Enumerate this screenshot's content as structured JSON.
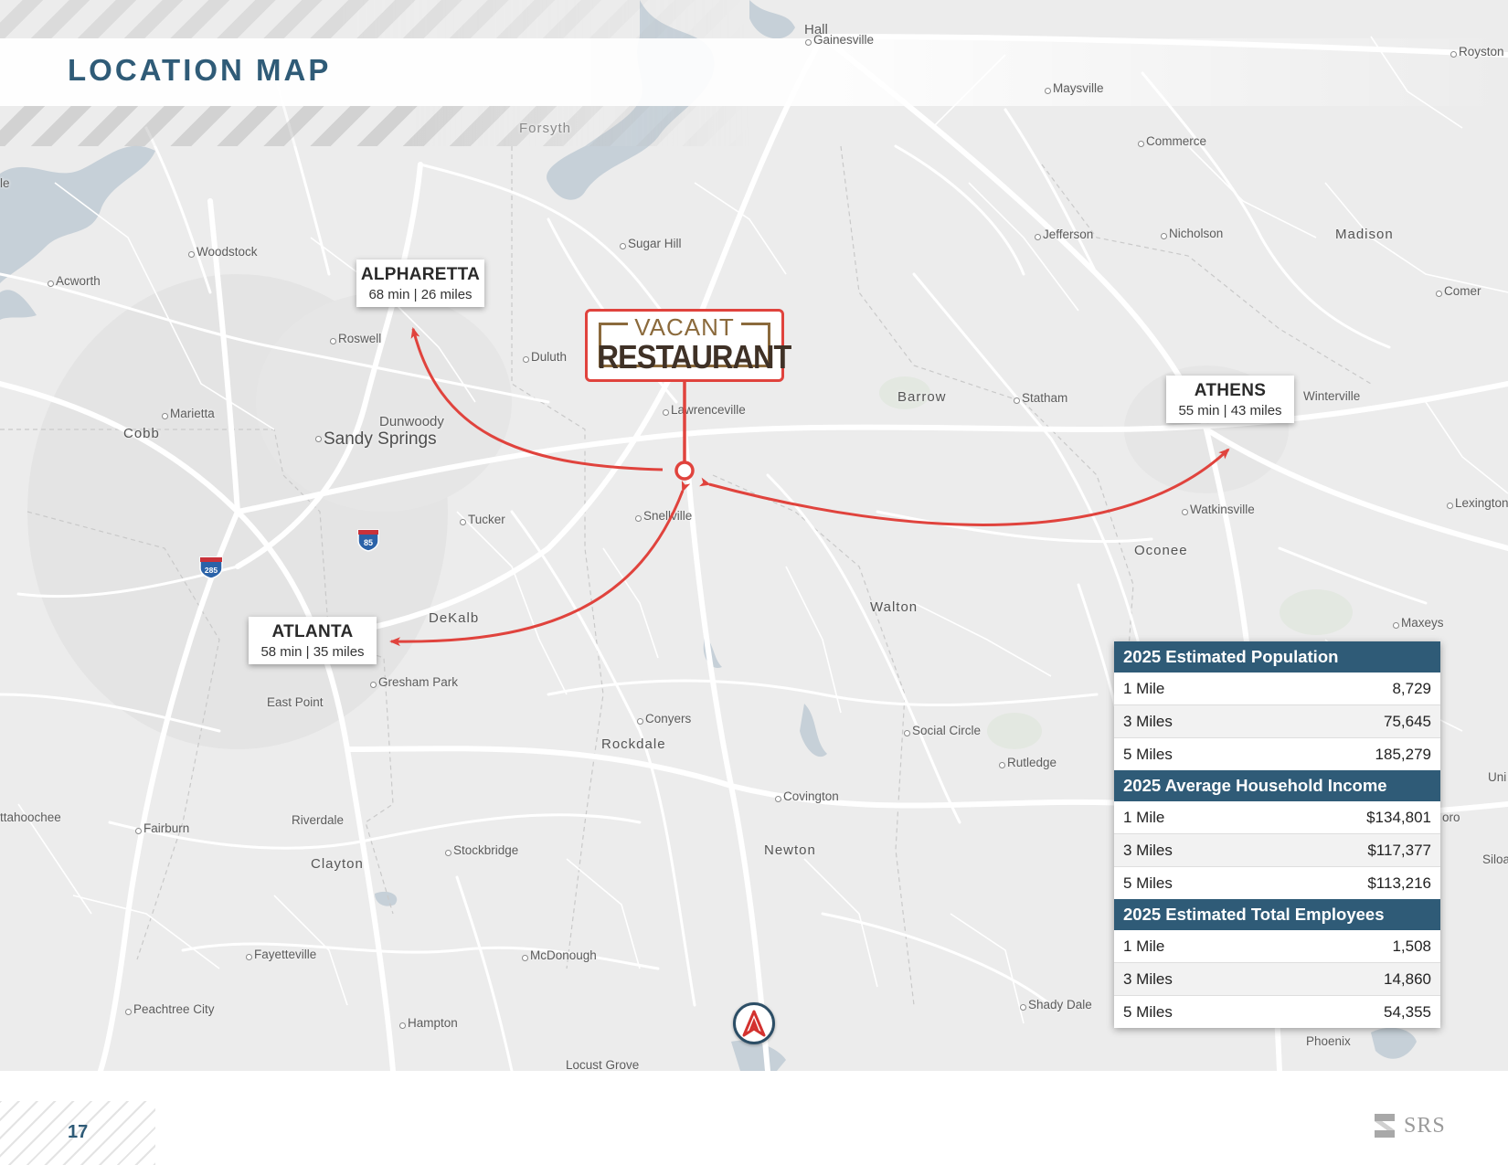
{
  "page": {
    "title": "LOCATION MAP",
    "page_number": "17",
    "logo_text": "SRS",
    "accent_color": "#2f5b77",
    "route_color": "#e0433d"
  },
  "site": {
    "label_top": "VACANT",
    "label_main": "RESTAURANT"
  },
  "destinations": [
    {
      "name": "ALPHARETTA",
      "distance": "68 min | 26 miles"
    },
    {
      "name": "ATHENS",
      "distance": "55 min | 43 miles"
    },
    {
      "name": "ATLANTA",
      "distance": "58 min | 35 miles"
    }
  ],
  "map_labels": {
    "hall": "Hall",
    "gainesville": "Gainesville",
    "royston": "Royston",
    "maysville": "Maysville",
    "forsyth": "Forsyth",
    "commerce": "Commerce",
    "woodstock": "Woodstock",
    "sugar_hill": "Sugar Hill",
    "jefferson": "Jefferson",
    "nicholson": "Nicholson",
    "madison": "Madison",
    "acworth": "Acworth",
    "comer": "Comer",
    "roswell": "Roswell",
    "duluth": "Duluth",
    "marietta": "Marietta",
    "cobb": "Cobb",
    "dunwoody": "Dunwoody",
    "sandy_springs": "Sandy Springs",
    "lawrenceville": "Lawrenceville",
    "barrow": "Barrow",
    "statham": "Statham",
    "winterville": "Winterville",
    "tucker": "Tucker",
    "snellville": "Snellville",
    "watkinsville": "Watkinsville",
    "lexington": "Lexington",
    "oconee": "Oconee",
    "dekalb": "DeKalb",
    "walton": "Walton",
    "maxeys": "Maxeys",
    "gresham_park": "Gresham Park",
    "east_point": "East Point",
    "conyers": "Conyers",
    "rockdale": "Rockdale",
    "social_circle": "Social Circle",
    "rutledge": "Rutledge",
    "covington": "Covington",
    "chattahoochee": "ttahoochee",
    "fairburn": "Fairburn",
    "riverdale": "Riverdale",
    "newton": "Newton",
    "stockbridge": "Stockbridge",
    "clayton": "Clayton",
    "fayetteville": "Fayetteville",
    "mcdonough": "McDonough",
    "peachtree_city": "Peachtree City",
    "hampton": "Hampton",
    "shady_dale": "Shady Dale",
    "phoenix": "Phoenix",
    "locust_grove": "Locust Grove",
    "uni": "Uni",
    "oro": "oro",
    "siloa": "Siloa",
    "le": "le",
    "i85": "85",
    "i285": "285"
  },
  "demographics": [
    {
      "heading": "2025 Estimated Population",
      "rows": [
        {
          "radius": "1 Mile",
          "value": "8,729"
        },
        {
          "radius": "3 Miles",
          "value": "75,645"
        },
        {
          "radius": "5 Miles",
          "value": "185,279"
        }
      ]
    },
    {
      "heading": "2025 Average Household Income",
      "rows": [
        {
          "radius": "1 Mile",
          "value": "$134,801"
        },
        {
          "radius": "3 Miles",
          "value": "$117,377"
        },
        {
          "radius": "5 Miles",
          "value": "$113,216"
        }
      ]
    },
    {
      "heading": "2025 Estimated Total Employees",
      "rows": [
        {
          "radius": "1 Mile",
          "value": "1,508"
        },
        {
          "radius": "3 Miles",
          "value": "14,860"
        },
        {
          "radius": "5 Miles",
          "value": "54,355"
        }
      ]
    }
  ]
}
